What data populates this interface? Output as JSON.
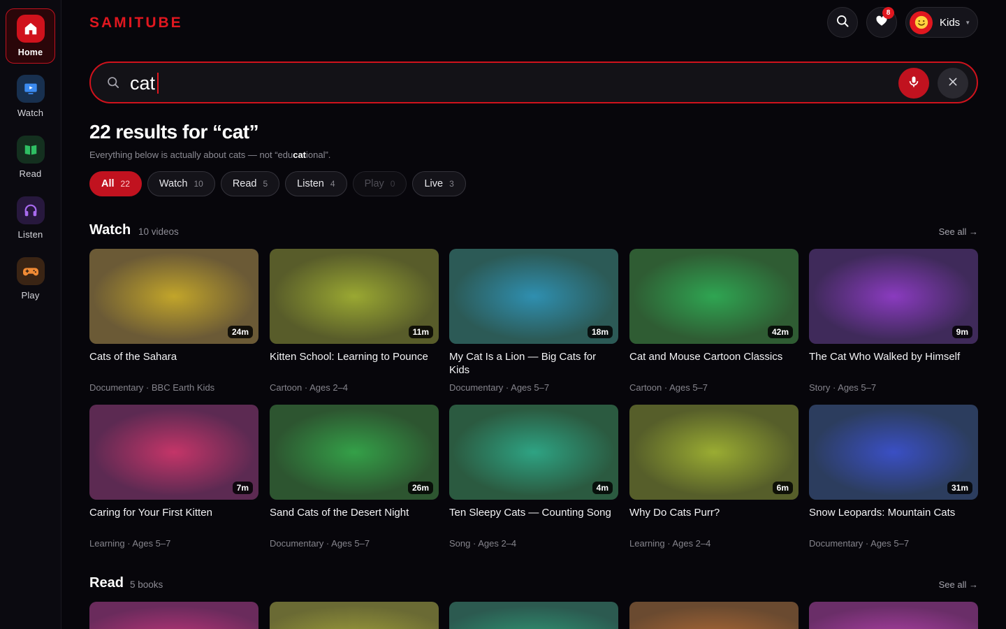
{
  "app": {
    "logo": "SAMITUBE"
  },
  "sidebar": {
    "items": [
      {
        "label": "Home",
        "icon": "home-icon",
        "active": true,
        "color": "#e0171f"
      },
      {
        "label": "Watch",
        "icon": "tv-icon",
        "active": false,
        "color": "#3b82f6"
      },
      {
        "label": "Read",
        "icon": "book-icon",
        "active": false,
        "color": "#22c55e"
      },
      {
        "label": "Listen",
        "icon": "headphones-icon",
        "active": false,
        "color": "#a855f7"
      },
      {
        "label": "Play",
        "icon": "gamepad-icon",
        "active": false,
        "color": "#f97316"
      }
    ]
  },
  "header": {
    "favorites_count": "8",
    "profile_name": "Kids"
  },
  "search": {
    "value": "cat",
    "placeholder": ""
  },
  "results": {
    "title": "22 results for “cat”",
    "subtitle_before": "Everything below is actually about cats — not “edu",
    "subtitle_bold": "cat",
    "subtitle_after": "ional”."
  },
  "filters": [
    {
      "label": "All",
      "count": "22",
      "state": "active"
    },
    {
      "label": "Watch",
      "count": "10",
      "state": "normal"
    },
    {
      "label": "Read",
      "count": "5",
      "state": "normal"
    },
    {
      "label": "Listen",
      "count": "4",
      "state": "normal"
    },
    {
      "label": "Play",
      "count": "0",
      "state": "disabled"
    },
    {
      "label": "Live",
      "count": "3",
      "state": "normal"
    }
  ],
  "watch_section": {
    "title": "Watch",
    "meta": "10 videos",
    "see_all": "See all →",
    "videos": [
      {
        "title": "Cats of the Sahara",
        "meta": "Documentary · BBC Earth Kids",
        "duration": "24m",
        "color": "#c2a52a",
        "base": "#6b5a36"
      },
      {
        "title": "Kitten School: Learning to Pounce",
        "meta": "Cartoon · Ages 2–4",
        "duration": "11m",
        "color": "#9aa832",
        "base": "#585c2a"
      },
      {
        "title": "My Cat Is a Lion — Big Cats for Kids",
        "meta": "Documentary · Ages 5–7",
        "duration": "18m",
        "color": "#2f8fb0",
        "base": "#2c5a56"
      },
      {
        "title": "Cat and Mouse Cartoon Classics",
        "meta": "Cartoon · Ages 5–7",
        "duration": "42m",
        "color": "#2fa552",
        "base": "#2f5c33"
      },
      {
        "title": "The Cat Who Walked by Himself",
        "meta": "Story · Ages 5–7",
        "duration": "9m",
        "color": "#8a3bbf",
        "base": "#3f2a5a"
      },
      {
        "title": "Caring for Your First Kitten",
        "meta": "Learning · Ages 5–7",
        "duration": "7m",
        "color": "#c43568",
        "base": "#5c2a52"
      },
      {
        "title": "Sand Cats of the Desert Night",
        "meta": "Documentary · Ages 5–7",
        "duration": "26m",
        "color": "#34a048",
        "base": "#2d5530"
      },
      {
        "title": "Ten Sleepy Cats — Counting Song",
        "meta": "Song · Ages 2–4",
        "duration": "4m",
        "color": "#2ea383",
        "base": "#2b5a40"
      },
      {
        "title": "Why Do Cats Purr?",
        "meta": "Learning · Ages 2–4",
        "duration": "6m",
        "color": "#9aac32",
        "base": "#565e2a"
      },
      {
        "title": "Snow Leopards: Mountain Cats",
        "meta": "Documentary · Ages 5–7",
        "duration": "31m",
        "color": "#3a4fc4",
        "base": "#2c3d5e"
      }
    ]
  },
  "read_section": {
    "title": "Read",
    "meta": "5 books",
    "see_all": "See all →",
    "books": [
      {
        "color": "#c0357a",
        "base": "#6a2b5c"
      },
      {
        "color": "#a0a03a",
        "base": "#6a6a34"
      },
      {
        "color": "#2f9a76",
        "base": "#2c5a50"
      },
      {
        "color": "#b06a35",
        "base": "#6a4a30"
      },
      {
        "color": "#b040a8",
        "base": "#6a2e68"
      }
    ]
  }
}
